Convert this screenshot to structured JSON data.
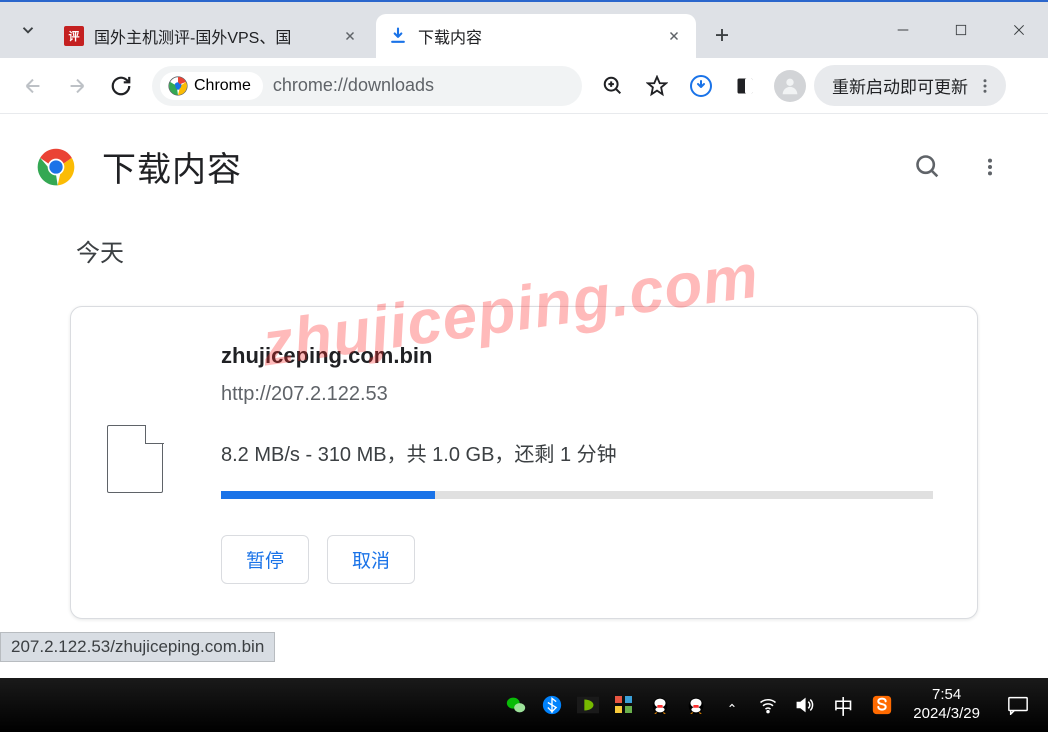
{
  "window": {
    "tabs": [
      {
        "title": "国外主机测评-国外VPS、国"
      },
      {
        "title": "下载内容"
      }
    ],
    "controls": {
      "minimize": "—",
      "maximize": "☐",
      "close": "✕"
    }
  },
  "toolbar": {
    "chipLabel": "Chrome",
    "url": "chrome://downloads",
    "updateLabel": "重新启动即可更新"
  },
  "page": {
    "title": "下载内容",
    "dateLabel": "今天"
  },
  "download": {
    "filename": "zhujiceping.com.bin",
    "url": "http://207.2.122.53",
    "progressText": "8.2 MB/s - 310 MB，共 1.0 GB，还剩 1 分钟",
    "progressPercent": 30,
    "pauseLabel": "暂停",
    "cancelLabel": "取消"
  },
  "statusTooltip": "207.2.122.53/zhujiceping.com.bin",
  "watermark": "zhujiceping.com",
  "taskbar": {
    "lang": "中",
    "time": "7:54",
    "date": "2024/3/29"
  }
}
